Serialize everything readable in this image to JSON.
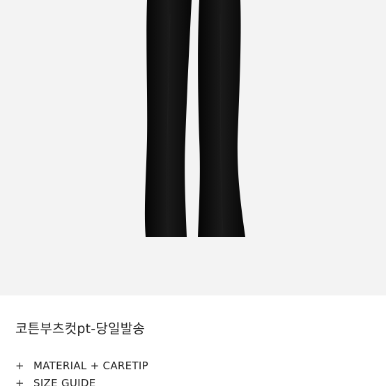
{
  "product": {
    "image_alt_icon": "black-flared-pants-image",
    "image_background": "#f3f3f3",
    "pants_color": "#0c0c0c",
    "title": "코튼부츠컷pt-당일발송"
  },
  "details": {
    "items": [
      {
        "plus": "+",
        "label": "MATERIAL + CARETIP"
      },
      {
        "plus": "+",
        "label": "SIZE GUIDE"
      }
    ]
  }
}
